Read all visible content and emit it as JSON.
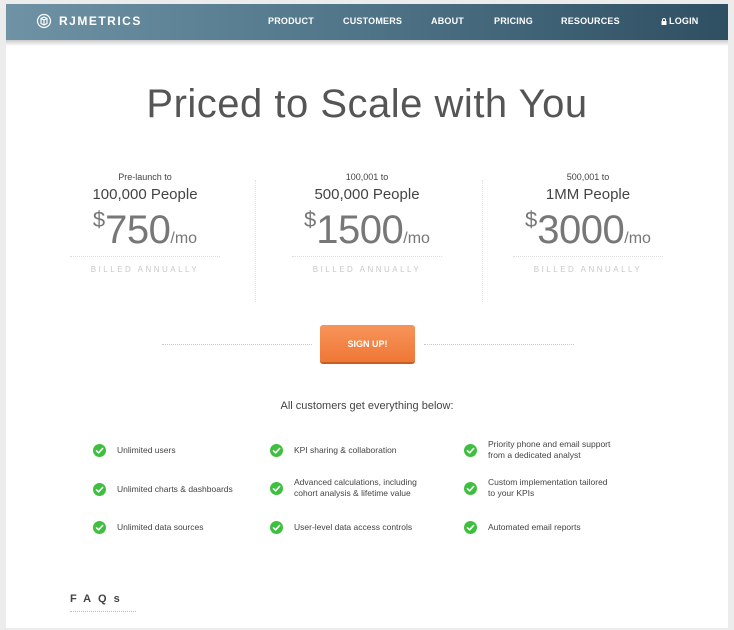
{
  "nav": {
    "logo": "RJMETRICS",
    "items": [
      "PRODUCT",
      "CUSTOMERS",
      "ABOUT",
      "PRICING",
      "RESOURCES"
    ],
    "login": "LOGIN"
  },
  "headline": "Priced to Scale with You",
  "plans": [
    {
      "range_small": "Pre-launch to",
      "range": "100,000 People",
      "currency": "$",
      "price": "750",
      "period": "/mo",
      "billing": "BILLED ANNUALLY"
    },
    {
      "range_small": "100,001 to",
      "range": "500,000 People",
      "currency": "$",
      "price": "1500",
      "period": "/mo",
      "billing": "BILLED ANNUALLY"
    },
    {
      "range_small": "500,001 to",
      "range": "1MM People",
      "currency": "$",
      "price": "3000",
      "period": "/mo",
      "billing": "BILLED ANNUALLY"
    }
  ],
  "signup_label": "SIGN UP!",
  "features_title": "All customers get everything below:",
  "features": {
    "col1": [
      "Unlimited users",
      "Unlimited charts & dashboards",
      "Unlimited data sources"
    ],
    "col2": [
      [
        "KPI sharing & collaboration"
      ],
      [
        "Advanced calculations, including",
        "cohort analysis & lifetime value"
      ],
      [
        "User-level data access controls"
      ]
    ],
    "col3": [
      [
        "Priority phone and email support",
        "from a dedicated analyst"
      ],
      [
        "Custom implementation tailored",
        "to your KPIs"
      ],
      [
        "Automated email reports"
      ]
    ]
  },
  "faq_label": "FAQs",
  "colors": {
    "nav_start": "#6f93a5",
    "nav_end": "#2f4f62",
    "accent_orange": "#ef7736",
    "check_green": "#3fbf3f"
  }
}
